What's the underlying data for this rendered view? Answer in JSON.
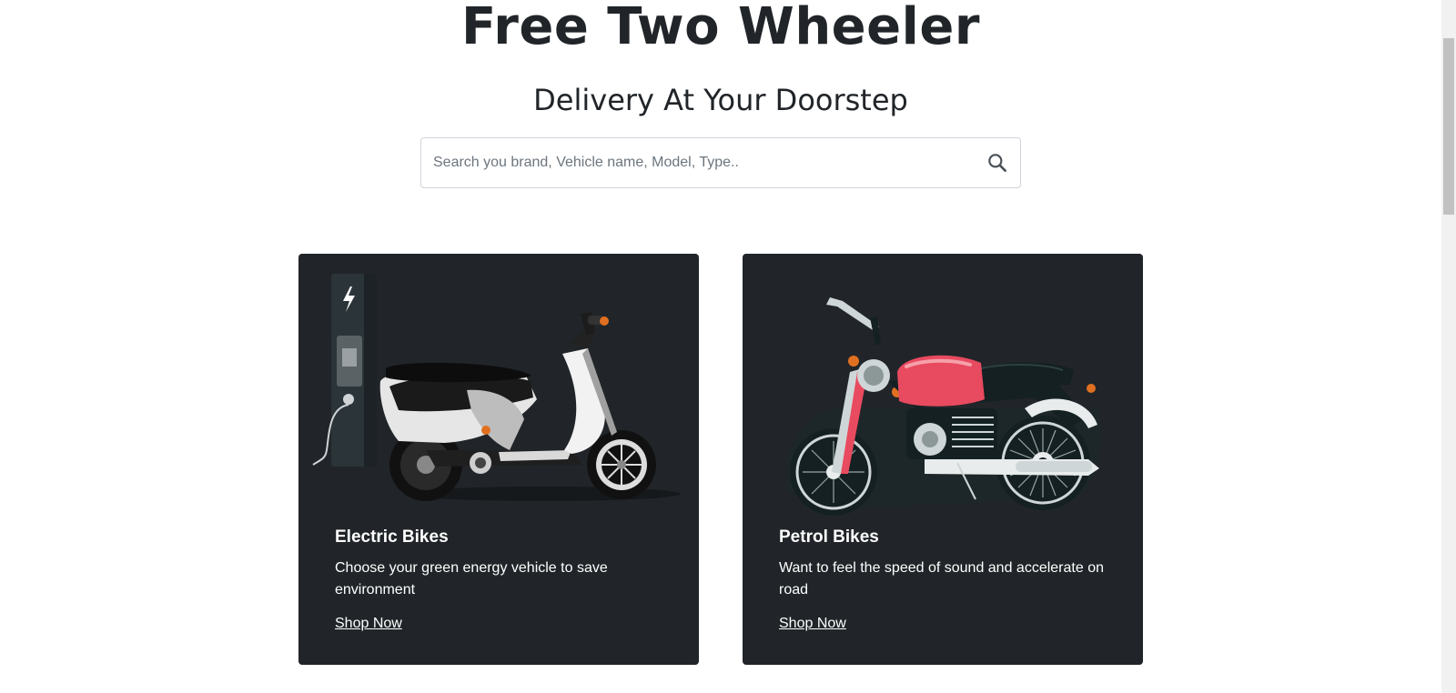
{
  "hero": {
    "title": "Free Two Wheeler",
    "subtitle": "Delivery At Your Doorstep"
  },
  "search": {
    "placeholder": "Search you brand, Vehicle name, Model, Type..",
    "value": "",
    "icon": "search-icon"
  },
  "cards": [
    {
      "title": "Electric Bikes",
      "text": "Choose your green energy vehicle to save environment",
      "link": "Shop Now",
      "image": "electric-scooter-illustration"
    },
    {
      "title": "Petrol Bikes",
      "text": "Want to feel the speed of sound and accelerate on road",
      "link": "Shop Now",
      "image": "motorcycle-illustration"
    }
  ],
  "colors": {
    "card_bg": "#212529",
    "text_dark": "#212529",
    "tank_red": "#e84a5f"
  }
}
